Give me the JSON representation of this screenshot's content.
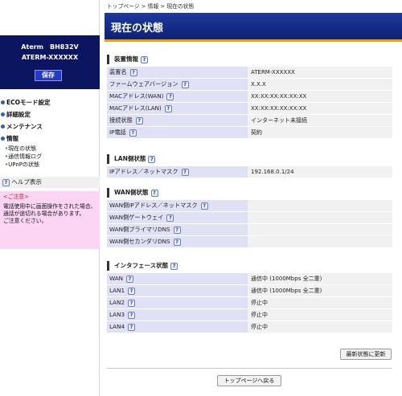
{
  "sidebar": {
    "model": "Aterm　BH832V",
    "device_name": "ATERM-XXXXXX",
    "save_label": "保存",
    "menu": [
      {
        "label": "ECOモード設定"
      },
      {
        "label": "詳細設定"
      },
      {
        "label": "メンテナンス"
      },
      {
        "label": "情報"
      }
    ],
    "sub_items": [
      "現在の状態",
      "通信情報ログ",
      "UPnPの状態"
    ],
    "help_label": "ヘルプ表示",
    "notice_title": "<ご注意>",
    "notice_text": "電話使用中に画面操作をされた場合、通話が途切れる場合があります。",
    "notice_text2": "ご注意ください。"
  },
  "breadcrumb": "トップページ > 情報 > 現在の状態",
  "page_title": "現在の状態",
  "sections": {
    "device": {
      "title": "装置情報",
      "rows": [
        {
          "label": "装置名",
          "value": "ATERM-XXXXXX"
        },
        {
          "label": "ファームウェアバージョン",
          "value": "X.X.X"
        },
        {
          "label": "MACアドレス(WAN)",
          "value": "XX:XX:XX:XX:XX:XX"
        },
        {
          "label": "MACアドレス(LAN)",
          "value": "XX:XX:XX:XX:XX:XX"
        },
        {
          "label": "接続状態",
          "value": "インターネット未接続"
        },
        {
          "label": "IP電話",
          "value": "契約"
        }
      ]
    },
    "lan": {
      "title": "LAN側状態",
      "rows": [
        {
          "label": "IPアドレス／ネットマスク",
          "value": "192.168.0.1/24"
        }
      ]
    },
    "wan": {
      "title": "WAN側状態",
      "rows": [
        {
          "label": "WAN側IPアドレス／ネットマスク",
          "value": ""
        },
        {
          "label": "WAN側ゲートウェイ",
          "value": ""
        },
        {
          "label": "WAN側プライマリDNS",
          "value": ""
        },
        {
          "label": "WAN側セカンダリDNS",
          "value": ""
        }
      ]
    },
    "iface": {
      "title": "インタフェース状態",
      "rows": [
        {
          "label": "WAN",
          "value": "通信中 (1000Mbps 全二重)"
        },
        {
          "label": "LAN1",
          "value": "通信中 (1000Mbps 全二重)"
        },
        {
          "label": "LAN2",
          "value": "停止中"
        },
        {
          "label": "LAN3",
          "value": "停止中"
        },
        {
          "label": "LAN4",
          "value": "停止中"
        }
      ]
    }
  },
  "buttons": {
    "refresh": "最新状態に更新",
    "top": "トップページへ戻る"
  },
  "help_icon_glyph": "?",
  "colors": {
    "router_box": "#0c1660",
    "title_bar": "#1d3a9c",
    "title_underline": "#f0a000",
    "label_cell": "#e1e1f6",
    "notice_bg": "#fcd4f4"
  }
}
